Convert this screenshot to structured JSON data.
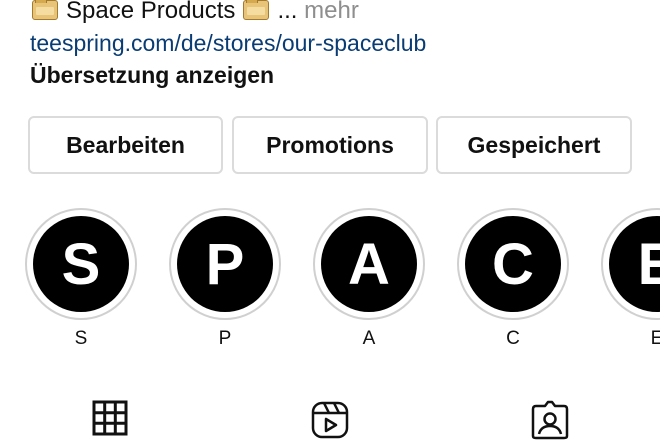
{
  "bio": {
    "title": "Space Products",
    "ellipsis": "...",
    "more_label": "mehr",
    "link": "teespring.com/de/stores/our-spaceclub",
    "translate_label": "Übersetzung anzeigen"
  },
  "actions": [
    {
      "label": "Bearbeiten"
    },
    {
      "label": "Promotions"
    },
    {
      "label": "Gespeichert"
    }
  ],
  "highlights": [
    {
      "letter": "S",
      "label": "S"
    },
    {
      "letter": "P",
      "label": "P"
    },
    {
      "letter": "A",
      "label": "A"
    },
    {
      "letter": "C",
      "label": "C"
    },
    {
      "letter": "E",
      "label": "E"
    }
  ],
  "tabs": [
    {
      "icon": "grid-icon"
    },
    {
      "icon": "reels-icon"
    },
    {
      "icon": "tagged-icon"
    }
  ]
}
